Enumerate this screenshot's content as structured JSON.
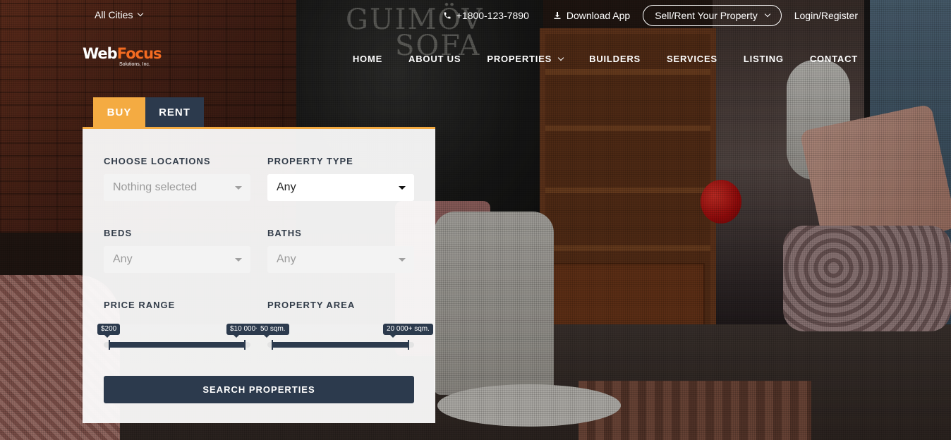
{
  "topbar": {
    "city_label": "All Cities",
    "phone": "+1800-123-7890",
    "download_label": "Download App",
    "sell_label": "Sell/Rent Your Property",
    "login_label": "Login/Register"
  },
  "logo": {
    "word1": "Web",
    "word2": "Focus",
    "sub": "Solutions, Inc."
  },
  "nav": {
    "items": [
      "HOME",
      "ABOUT US",
      "PROPERTIES",
      "BUILDERS",
      "SERVICES",
      "LISTING",
      "CONTACT"
    ]
  },
  "search": {
    "tabs": {
      "buy": "BUY",
      "rent": "RENT"
    },
    "locations": {
      "label": "CHOOSE LOCATIONS",
      "value": "Nothing selected"
    },
    "property_type": {
      "label": "PROPERTY TYPE",
      "value": "Any"
    },
    "beds": {
      "label": "BEDS",
      "value": "Any"
    },
    "baths": {
      "label": "BATHS",
      "value": "Any"
    },
    "price": {
      "label": "PRICE RANGE",
      "min": "$200",
      "max": "$10 000+"
    },
    "area": {
      "label": "PROPERTY AREA",
      "min": "50 sqm.",
      "max": "20 000+ sqm."
    },
    "button": "SEARCH PROPERTIES"
  },
  "colors": {
    "accent": "#f4ab42",
    "navy": "#2c3a4d"
  }
}
